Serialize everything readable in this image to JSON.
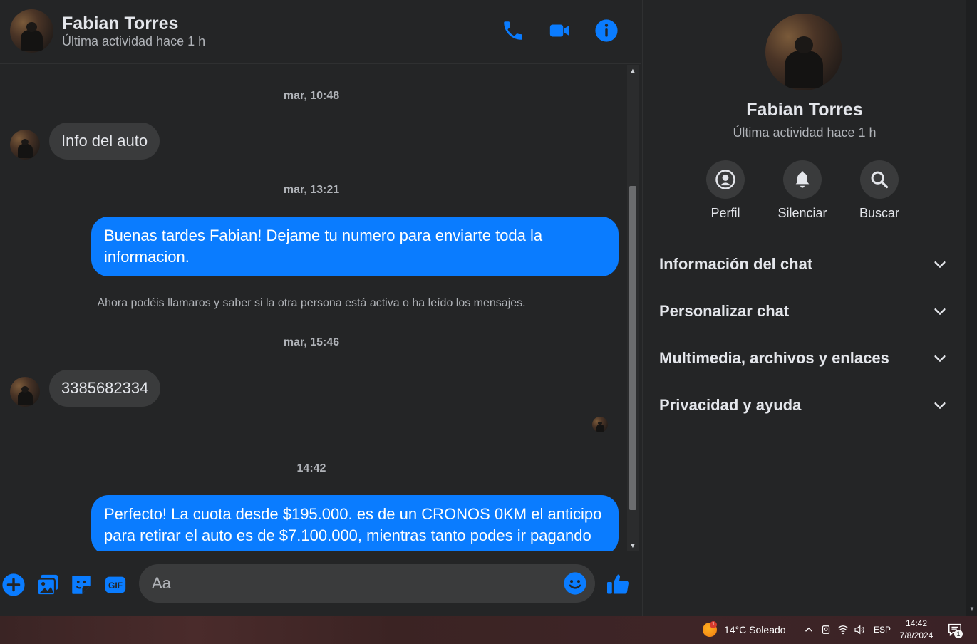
{
  "header": {
    "name": "Fabian Torres",
    "status": "Última actividad hace 1 h",
    "icons": [
      "phone-icon",
      "video-camera-icon",
      "info-icon"
    ]
  },
  "conversation": [
    {
      "type": "timestamp",
      "text": "mar, 10:48"
    },
    {
      "type": "incoming",
      "text": "Info del auto"
    },
    {
      "type": "timestamp",
      "text": "mar, 13:21"
    },
    {
      "type": "outgoing",
      "text": "Buenas tardes Fabian! Dejame tu numero para enviarte toda la informacion."
    },
    {
      "type": "system",
      "text": "Ahora podéis llamaros y saber si la otra persona está activa o ha leído los mensajes."
    },
    {
      "type": "timestamp",
      "text": "mar, 15:46"
    },
    {
      "type": "incoming",
      "text": "3385682334"
    },
    {
      "type": "timestamp",
      "text": "14:42"
    },
    {
      "type": "outgoing",
      "text": "Perfecto! La cuota desde $195.000. es de un CRONOS 0KM el anticipo para retirar el auto es de $7.100.000, mientras tanto podes ir pagando"
    }
  ],
  "composer": {
    "placeholder": "Aa",
    "icons": [
      "plus-icon",
      "image-icon",
      "sticker-icon",
      "gif-icon",
      "emoji-icon",
      "thumbs-up-icon"
    ]
  },
  "side_panel": {
    "name": "Fabian Torres",
    "status": "Última actividad hace 1 h",
    "actions": [
      {
        "label": "Perfil",
        "icon": "profile-icon"
      },
      {
        "label": "Silenciar",
        "icon": "bell-icon"
      },
      {
        "label": "Buscar",
        "icon": "search-icon"
      }
    ],
    "sections": [
      {
        "label": "Información del chat"
      },
      {
        "label": "Personalizar chat"
      },
      {
        "label": "Multimedia, archivos y enlaces"
      },
      {
        "label": "Privacidad y ayuda"
      }
    ]
  },
  "taskbar": {
    "weather": "14°C  Soleado",
    "weather_badge": "1",
    "language": "ESP",
    "time": "14:42",
    "date": "7/8/2024",
    "notification_count": "1"
  },
  "colors": {
    "accent": "#0a7cff",
    "background": "#242526",
    "bubble_incoming": "#3a3b3c",
    "text_secondary": "#b0b3b8"
  }
}
